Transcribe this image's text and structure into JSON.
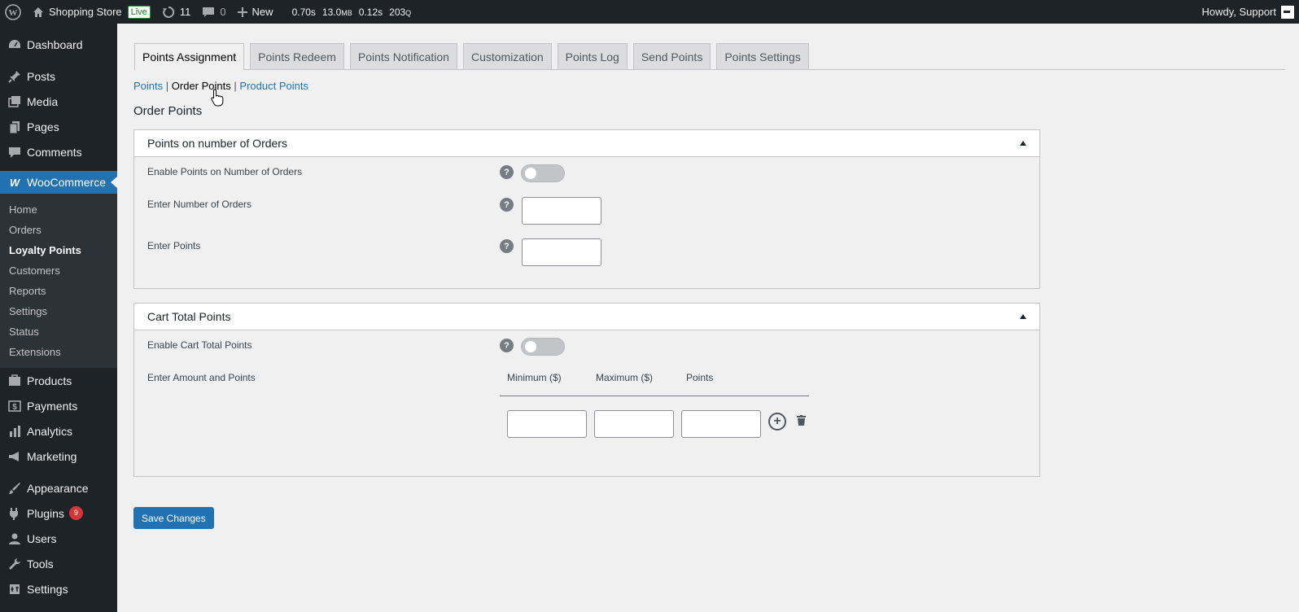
{
  "adminbar": {
    "site_name": "Shopping Store",
    "live_label": "Live",
    "updates_count": "11",
    "comments_count": "0",
    "new_label": "New",
    "stat_time1": "0.70s",
    "stat_mem_value": "13.0",
    "stat_mem_unit": "MB",
    "stat_time2": "0.12s",
    "stat_queries_value": "203",
    "stat_queries_unit": "Q",
    "howdy": "Howdy, Support"
  },
  "sidebar": {
    "top_items": [
      {
        "label": "Dashboard",
        "icon": "dashboard-icon"
      },
      {
        "label": "Posts",
        "icon": "pin-icon"
      },
      {
        "label": "Media",
        "icon": "media-icon"
      },
      {
        "label": "Pages",
        "icon": "pages-icon"
      },
      {
        "label": "Comments",
        "icon": "comment-icon"
      }
    ],
    "woocommerce": {
      "label": "WooCommerce",
      "icon": "woocommerce-icon"
    },
    "submenu": [
      "Home",
      "Orders",
      "Loyalty Points",
      "Customers",
      "Reports",
      "Settings",
      "Status",
      "Extensions"
    ],
    "submenu_current": "Loyalty Points",
    "mid_items": [
      {
        "label": "Products",
        "icon": "products-icon"
      },
      {
        "label": "Payments",
        "icon": "payments-icon"
      },
      {
        "label": "Analytics",
        "icon": "analytics-icon"
      },
      {
        "label": "Marketing",
        "icon": "megaphone-icon"
      }
    ],
    "bottom_items": [
      {
        "label": "Appearance",
        "icon": "brush-icon"
      },
      {
        "label": "Plugins",
        "icon": "plugin-icon",
        "badge": "9"
      },
      {
        "label": "Users",
        "icon": "user-icon"
      },
      {
        "label": "Tools",
        "icon": "wrench-icon"
      },
      {
        "label": "Settings",
        "icon": "settings-icon"
      }
    ]
  },
  "tabs": [
    "Points Assignment",
    "Points Redeem",
    "Points Notification",
    "Customization",
    "Points Log",
    "Send Points",
    "Points Settings"
  ],
  "active_tab": "Points Assignment",
  "subnav": {
    "points": "Points",
    "sep": "|",
    "order_points": "Order Points",
    "product_points": "Product Points"
  },
  "page_title": "Order Points",
  "orders_panel": {
    "title": "Points on number of Orders",
    "enable_label": "Enable Points on Number of Orders",
    "number_label": "Enter Number of Orders",
    "points_label": "Enter Points",
    "enabled": false,
    "number_value": "",
    "points_value": ""
  },
  "cart_panel": {
    "title": "Cart Total Points",
    "enable_label": "Enable Cart Total Points",
    "amount_label": "Enter Amount and Points",
    "col_min": "Minimum ($)",
    "col_max": "Maximum ($)",
    "col_points": "Points",
    "enabled": false,
    "row": {
      "min": "",
      "max": "",
      "points": ""
    }
  },
  "help_glyph": "?",
  "add_glyph": "+",
  "save_label": "Save Changes",
  "colors": {
    "accent": "#2271b1",
    "adminbar": "#1d2327",
    "badge": "#d63638"
  }
}
